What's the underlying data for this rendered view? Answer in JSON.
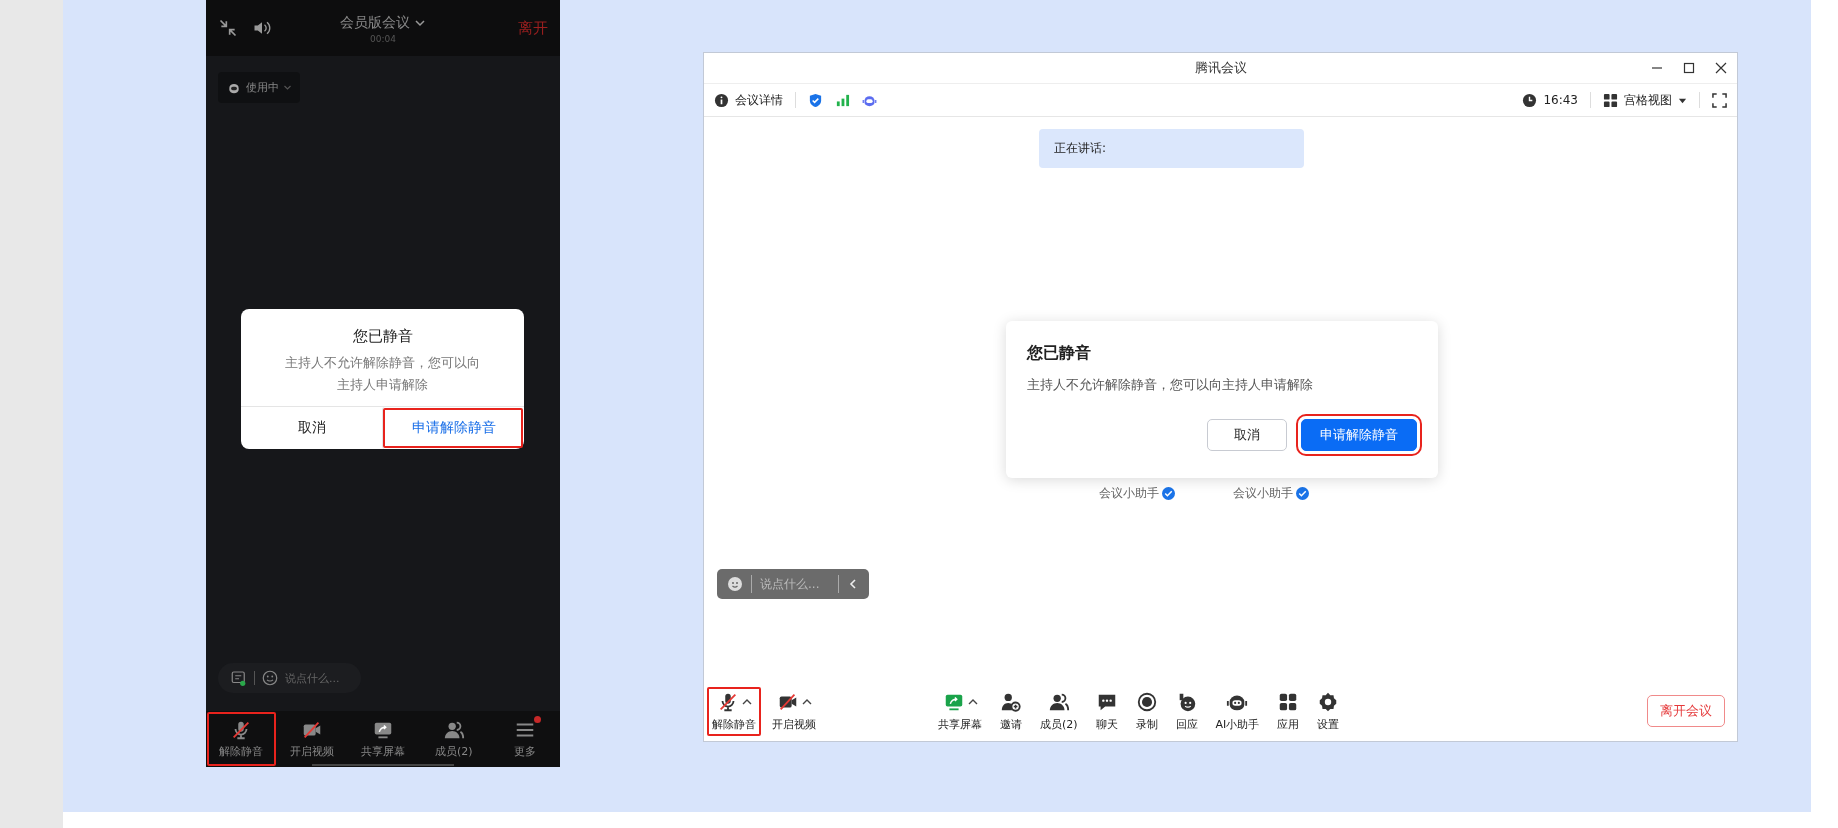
{
  "phone": {
    "title": "会员版会议",
    "duration": "00:04",
    "leave": "离开",
    "status_pill": "使用中",
    "dialog": {
      "title": "您已静音",
      "message": "主持人不允许解除静音，您可以向主持人申请解除",
      "buttons": [
        {
          "label": "取消",
          "kind": "secondary",
          "highlighted": false
        },
        {
          "label": "申请解除静音",
          "kind": "primary",
          "highlighted": true
        }
      ]
    },
    "chat_placeholder": "说点什么...",
    "toolbar": [
      {
        "label": "解除静音",
        "kind": "mic-off",
        "highlighted": true,
        "badge": false
      },
      {
        "label": "开启视频",
        "kind": "camera-off",
        "highlighted": false,
        "badge": false
      },
      {
        "label": "共享屏幕",
        "kind": "share",
        "highlighted": false,
        "badge": false
      },
      {
        "label": "成员(2)",
        "kind": "members",
        "highlighted": false,
        "badge": false
      },
      {
        "label": "更多",
        "kind": "menu",
        "highlighted": false,
        "badge": true
      }
    ]
  },
  "desktop": {
    "window": {
      "title": "腾讯会议"
    },
    "topbar": {
      "details": "会议详情",
      "time": "16:43",
      "view": "宫格视图"
    },
    "speaking": "正在讲话:",
    "participants": [
      "会议小助手",
      "会议小助手"
    ],
    "dialog": {
      "title": "您已静音",
      "message": "主持人不允许解除静音，您可以向主持人申请解除",
      "buttons": [
        {
          "label": "取消",
          "kind": "secondary",
          "highlighted": false
        },
        {
          "label": "申请解除静音",
          "kind": "primary",
          "highlighted": true
        }
      ]
    },
    "chat_placeholder": "说点什么...",
    "toolbar_left": [
      {
        "label": "解除静音",
        "kind": "mic-off",
        "caret": true,
        "highlighted": true
      },
      {
        "label": "开启视频",
        "kind": "camera-off",
        "caret": true,
        "highlighted": false
      }
    ],
    "toolbar_center": [
      {
        "label": "共享屏幕",
        "kind": "share",
        "caret": true,
        "highlighted": false
      },
      {
        "label": "邀请",
        "kind": "invite",
        "caret": false,
        "highlighted": false
      },
      {
        "label": "成员(2)",
        "kind": "members",
        "caret": false,
        "highlighted": false
      },
      {
        "label": "聊天",
        "kind": "chat",
        "caret": false,
        "highlighted": false
      },
      {
        "label": "录制",
        "kind": "record",
        "caret": false,
        "highlighted": false
      },
      {
        "label": "回应",
        "kind": "react",
        "caret": false,
        "highlighted": false
      },
      {
        "label": "AI小助手",
        "kind": "bot",
        "caret": false,
        "highlighted": false
      },
      {
        "label": "应用",
        "kind": "apps",
        "caret": false,
        "highlighted": false
      },
      {
        "label": "设置",
        "kind": "settings",
        "caret": false,
        "highlighted": false
      }
    ],
    "leave": "离开会议"
  }
}
